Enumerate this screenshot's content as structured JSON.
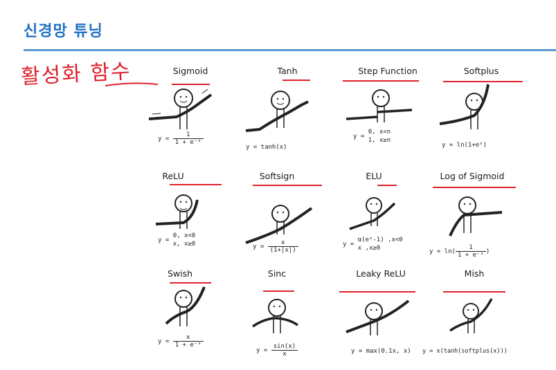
{
  "slide": {
    "title": "신경망 튜닝",
    "handwritten_note": "활성화 함수"
  },
  "functions": [
    {
      "name": "Sigmoid",
      "formula_lhs": "y =",
      "numerator": "1",
      "denominator": "1 + e⁻ˣ"
    },
    {
      "name": "Tanh",
      "formula": "y = tanh(x)"
    },
    {
      "name": "Step Function",
      "formula_lhs": "y =",
      "piece1": "0,  x<n",
      "piece2": "1,  x≥n"
    },
    {
      "name": "Softplus",
      "formula": "y = ln(1+eˣ)"
    },
    {
      "name": "ReLU",
      "formula_lhs": "y =",
      "piece1": "0,  x<0",
      "piece2": "x,  x≥0"
    },
    {
      "name": "Softsign",
      "formula_lhs": "y =",
      "numerator": "x",
      "denominator": "(1+|x|)"
    },
    {
      "name": "ELU",
      "formula_lhs": "y =",
      "piece1": "α(eˣ-1) ,x<0",
      "piece2": "x       ,x≥0"
    },
    {
      "name": "Log of Sigmoid",
      "formula_lhs": "y = ln",
      "numerator": "1",
      "denominator": "1 + e⁻ˣ"
    },
    {
      "name": "Swish",
      "formula_lhs": "y =",
      "numerator": "x",
      "denominator": "1 + e⁻ˣ"
    },
    {
      "name": "Sinc",
      "formula_lhs": "y =",
      "numerator": "sin(x)",
      "denominator": "x"
    },
    {
      "name": "Leaky ReLU",
      "formula": "y = max(0.1x, x)"
    },
    {
      "name": "Mish",
      "formula": "y = x(tanh(softplus(x)))"
    }
  ],
  "colors": {
    "title": "#1f6fc4",
    "rule": "#5b9bd5",
    "annotation": "#e0202a"
  }
}
